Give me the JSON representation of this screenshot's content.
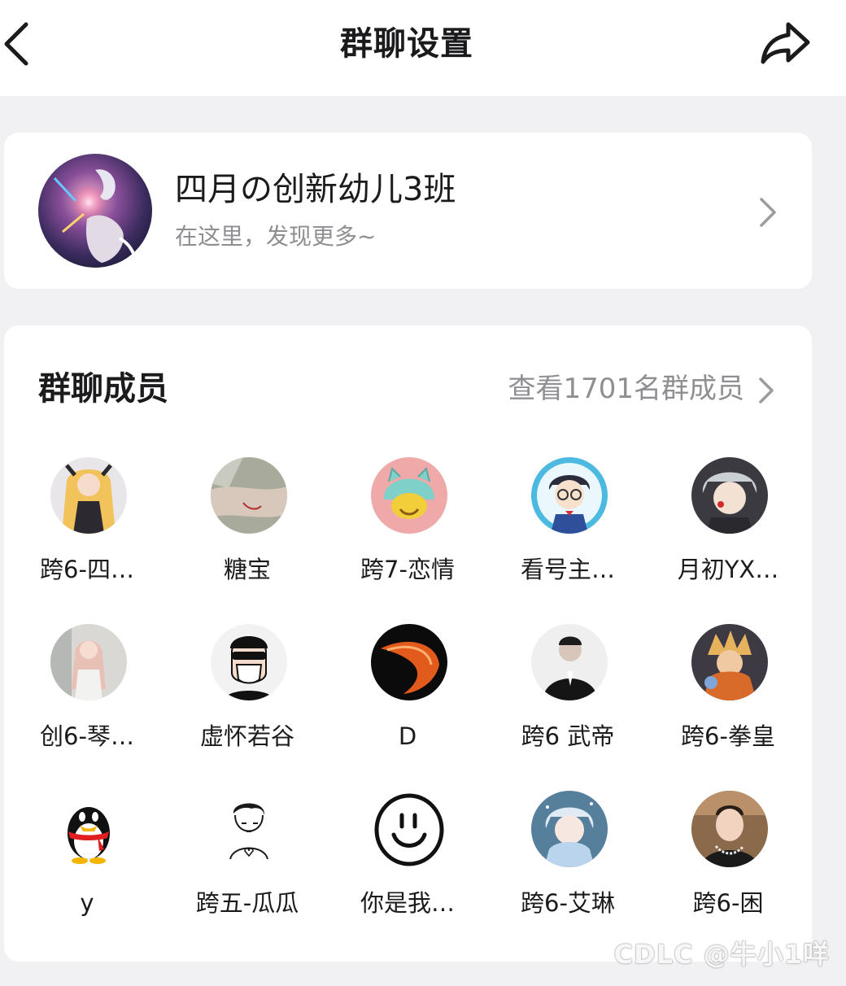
{
  "header": {
    "title": "群聊设置",
    "back_icon": "chevron-left-icon",
    "share_icon": "share-arrow-icon"
  },
  "group": {
    "name": "四月の创新幼儿3班",
    "subtitle": "在这里，发现更多~"
  },
  "members_section": {
    "title": "群聊成员",
    "view_all_label": "查看1701名群成员",
    "members": [
      {
        "name": "跨6-四…",
        "avatar": "anime-girl-blonde"
      },
      {
        "name": "糖宝",
        "avatar": "photo-wrist"
      },
      {
        "name": "跨7-恋情",
        "avatar": "cartoon-cat-hood"
      },
      {
        "name": "看号主…",
        "avatar": "anime-boy-glasses"
      },
      {
        "name": "月初YX…",
        "avatar": "anime-boy-white-hair"
      },
      {
        "name": "创6-琴…",
        "avatar": "photo-girl-pink-hair"
      },
      {
        "name": "虚怀若谷",
        "avatar": "masked-man-sunglasses"
      },
      {
        "name": "D",
        "avatar": "red-swoosh-logo"
      },
      {
        "name": "跨6 武帝",
        "avatar": "photo-man-suit"
      },
      {
        "name": "跨6-拳皇",
        "avatar": "anime-fighter"
      },
      {
        "name": "y",
        "avatar": "qq-penguin"
      },
      {
        "name": "跨五-瓜瓜",
        "avatar": "line-drawing-boy"
      },
      {
        "name": "你是我…",
        "avatar": "smiley-face"
      },
      {
        "name": "跨6-艾琳",
        "avatar": "anime-boy-blue-hair"
      },
      {
        "name": "跨6-困",
        "avatar": "photo-man-chain"
      }
    ]
  },
  "watermark": "CDLC @牛小1咩"
}
